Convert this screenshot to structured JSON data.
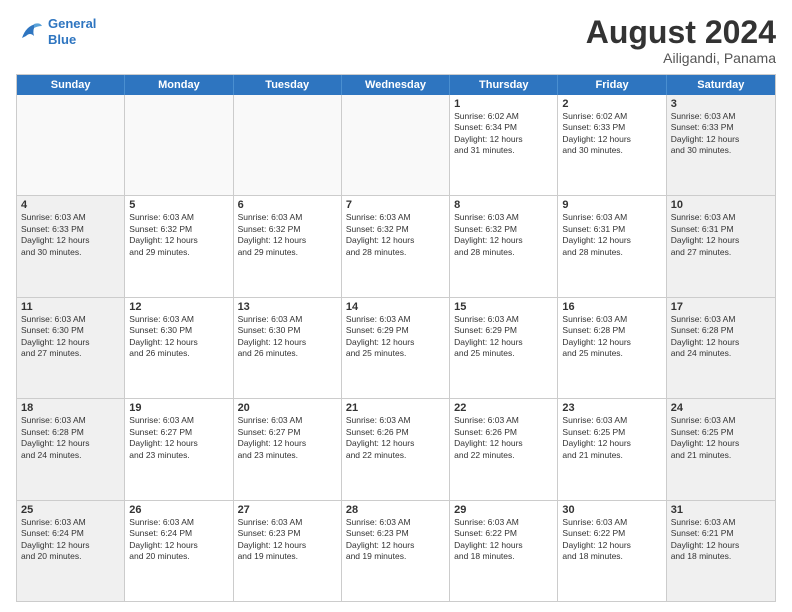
{
  "header": {
    "logo_line1": "General",
    "logo_line2": "Blue",
    "month_year": "August 2024",
    "location": "Ailigandi, Panama"
  },
  "days_of_week": [
    "Sunday",
    "Monday",
    "Tuesday",
    "Wednesday",
    "Thursday",
    "Friday",
    "Saturday"
  ],
  "weeks": [
    [
      {
        "day": "",
        "text": ""
      },
      {
        "day": "",
        "text": ""
      },
      {
        "day": "",
        "text": ""
      },
      {
        "day": "",
        "text": ""
      },
      {
        "day": "1",
        "text": "Sunrise: 6:02 AM\nSunset: 6:34 PM\nDaylight: 12 hours\nand 31 minutes."
      },
      {
        "day": "2",
        "text": "Sunrise: 6:02 AM\nSunset: 6:33 PM\nDaylight: 12 hours\nand 30 minutes."
      },
      {
        "day": "3",
        "text": "Sunrise: 6:03 AM\nSunset: 6:33 PM\nDaylight: 12 hours\nand 30 minutes."
      }
    ],
    [
      {
        "day": "4",
        "text": "Sunrise: 6:03 AM\nSunset: 6:33 PM\nDaylight: 12 hours\nand 30 minutes."
      },
      {
        "day": "5",
        "text": "Sunrise: 6:03 AM\nSunset: 6:32 PM\nDaylight: 12 hours\nand 29 minutes."
      },
      {
        "day": "6",
        "text": "Sunrise: 6:03 AM\nSunset: 6:32 PM\nDaylight: 12 hours\nand 29 minutes."
      },
      {
        "day": "7",
        "text": "Sunrise: 6:03 AM\nSunset: 6:32 PM\nDaylight: 12 hours\nand 28 minutes."
      },
      {
        "day": "8",
        "text": "Sunrise: 6:03 AM\nSunset: 6:32 PM\nDaylight: 12 hours\nand 28 minutes."
      },
      {
        "day": "9",
        "text": "Sunrise: 6:03 AM\nSunset: 6:31 PM\nDaylight: 12 hours\nand 28 minutes."
      },
      {
        "day": "10",
        "text": "Sunrise: 6:03 AM\nSunset: 6:31 PM\nDaylight: 12 hours\nand 27 minutes."
      }
    ],
    [
      {
        "day": "11",
        "text": "Sunrise: 6:03 AM\nSunset: 6:30 PM\nDaylight: 12 hours\nand 27 minutes."
      },
      {
        "day": "12",
        "text": "Sunrise: 6:03 AM\nSunset: 6:30 PM\nDaylight: 12 hours\nand 26 minutes."
      },
      {
        "day": "13",
        "text": "Sunrise: 6:03 AM\nSunset: 6:30 PM\nDaylight: 12 hours\nand 26 minutes."
      },
      {
        "day": "14",
        "text": "Sunrise: 6:03 AM\nSunset: 6:29 PM\nDaylight: 12 hours\nand 25 minutes."
      },
      {
        "day": "15",
        "text": "Sunrise: 6:03 AM\nSunset: 6:29 PM\nDaylight: 12 hours\nand 25 minutes."
      },
      {
        "day": "16",
        "text": "Sunrise: 6:03 AM\nSunset: 6:28 PM\nDaylight: 12 hours\nand 25 minutes."
      },
      {
        "day": "17",
        "text": "Sunrise: 6:03 AM\nSunset: 6:28 PM\nDaylight: 12 hours\nand 24 minutes."
      }
    ],
    [
      {
        "day": "18",
        "text": "Sunrise: 6:03 AM\nSunset: 6:28 PM\nDaylight: 12 hours\nand 24 minutes."
      },
      {
        "day": "19",
        "text": "Sunrise: 6:03 AM\nSunset: 6:27 PM\nDaylight: 12 hours\nand 23 minutes."
      },
      {
        "day": "20",
        "text": "Sunrise: 6:03 AM\nSunset: 6:27 PM\nDaylight: 12 hours\nand 23 minutes."
      },
      {
        "day": "21",
        "text": "Sunrise: 6:03 AM\nSunset: 6:26 PM\nDaylight: 12 hours\nand 22 minutes."
      },
      {
        "day": "22",
        "text": "Sunrise: 6:03 AM\nSunset: 6:26 PM\nDaylight: 12 hours\nand 22 minutes."
      },
      {
        "day": "23",
        "text": "Sunrise: 6:03 AM\nSunset: 6:25 PM\nDaylight: 12 hours\nand 21 minutes."
      },
      {
        "day": "24",
        "text": "Sunrise: 6:03 AM\nSunset: 6:25 PM\nDaylight: 12 hours\nand 21 minutes."
      }
    ],
    [
      {
        "day": "25",
        "text": "Sunrise: 6:03 AM\nSunset: 6:24 PM\nDaylight: 12 hours\nand 20 minutes."
      },
      {
        "day": "26",
        "text": "Sunrise: 6:03 AM\nSunset: 6:24 PM\nDaylight: 12 hours\nand 20 minutes."
      },
      {
        "day": "27",
        "text": "Sunrise: 6:03 AM\nSunset: 6:23 PM\nDaylight: 12 hours\nand 19 minutes."
      },
      {
        "day": "28",
        "text": "Sunrise: 6:03 AM\nSunset: 6:23 PM\nDaylight: 12 hours\nand 19 minutes."
      },
      {
        "day": "29",
        "text": "Sunrise: 6:03 AM\nSunset: 6:22 PM\nDaylight: 12 hours\nand 18 minutes."
      },
      {
        "day": "30",
        "text": "Sunrise: 6:03 AM\nSunset: 6:22 PM\nDaylight: 12 hours\nand 18 minutes."
      },
      {
        "day": "31",
        "text": "Sunrise: 6:03 AM\nSunset: 6:21 PM\nDaylight: 12 hours\nand 18 minutes."
      }
    ]
  ]
}
